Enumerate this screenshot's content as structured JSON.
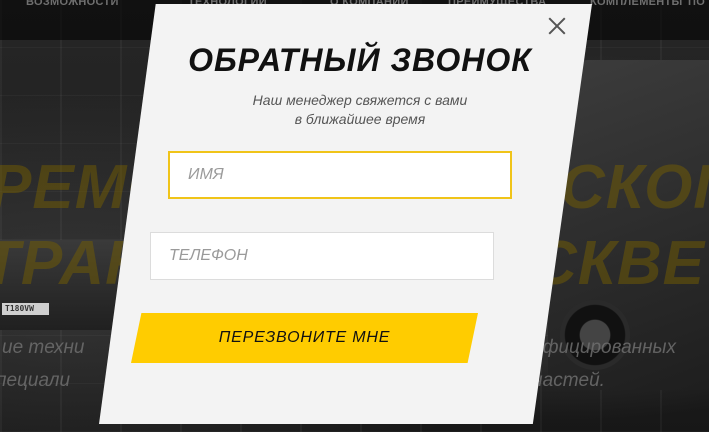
{
  "background": {
    "nav": [
      "ВОЗМОЖНОСТИ",
      "ТЕХНОЛОГИИ",
      "О КОМПАНИИ",
      "ПРЕИМУЩЕСТВА",
      "КОМПЛЕМЕНТЫ",
      "ПО"
    ],
    "headline": [
      "РЕМОНТ",
      "СКОГО",
      "ТРАНС",
      "СКВЕ"
    ],
    "sub_lines": [
      "ие техни",
      "ифицированных",
      "пециали",
      "апчастей."
    ],
    "plate": "T180VW"
  },
  "modal": {
    "title": "ОБРАТНЫЙ ЗВОНОК",
    "subtitle_line1": "Наш менеджер свяжется с вами",
    "subtitle_line2": "в ближайшее время",
    "name_placeholder": "ИМЯ",
    "phone_placeholder": "ТЕЛЕФОН",
    "submit_label": "ПЕРЕЗВОНИТЕ МНЕ",
    "close_icon": "close-icon"
  },
  "colors": {
    "accent": "#ffcc00",
    "panel": "#f3f3f3",
    "overlay": "#1b1b1b"
  }
}
